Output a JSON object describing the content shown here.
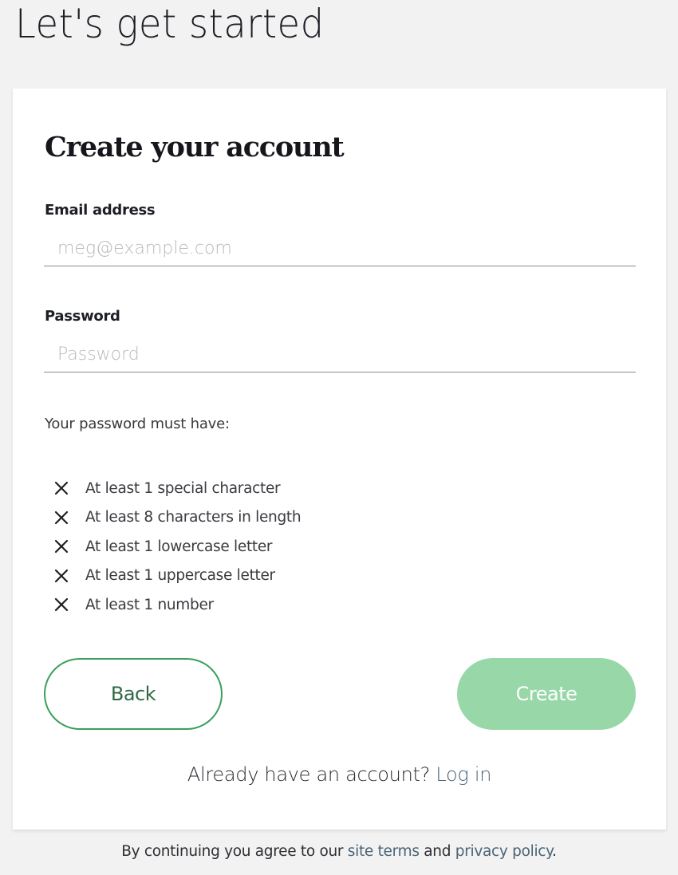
{
  "page": {
    "heading": "Let's get started"
  },
  "card": {
    "title": "Create your account",
    "email": {
      "label": "Email address",
      "value": "",
      "placeholder": "meg@example.com"
    },
    "password": {
      "label": "Password",
      "value": "",
      "placeholder": "Password"
    },
    "requirements_intro": "Your password must have:",
    "requirements": [
      {
        "icon": "x-icon",
        "met": false,
        "text": "At least 1 special character"
      },
      {
        "icon": "x-icon",
        "met": false,
        "text": "At least 8 characters in length"
      },
      {
        "icon": "x-icon",
        "met": false,
        "text": "At least 1 lowercase letter"
      },
      {
        "icon": "x-icon",
        "met": false,
        "text": "At least 1 uppercase letter"
      },
      {
        "icon": "x-icon",
        "met": false,
        "text": "At least 1 number"
      }
    ],
    "buttons": {
      "back_label": "Back",
      "create_label": "Create",
      "create_disabled": true
    },
    "login_prompt": {
      "text": "Already have an account?",
      "link_label": "Log in"
    }
  },
  "footer": {
    "prefix": "By continuing you agree to our",
    "terms_link": "site terms",
    "conjunction": "and",
    "privacy_link": "privacy policy",
    "suffix": "."
  },
  "colors": {
    "background": "#f2f2f2",
    "card": "#ffffff",
    "accent_green": "#3a9f5b",
    "create_disabled_bg": "#97d7a8",
    "link": "#4a6478"
  }
}
